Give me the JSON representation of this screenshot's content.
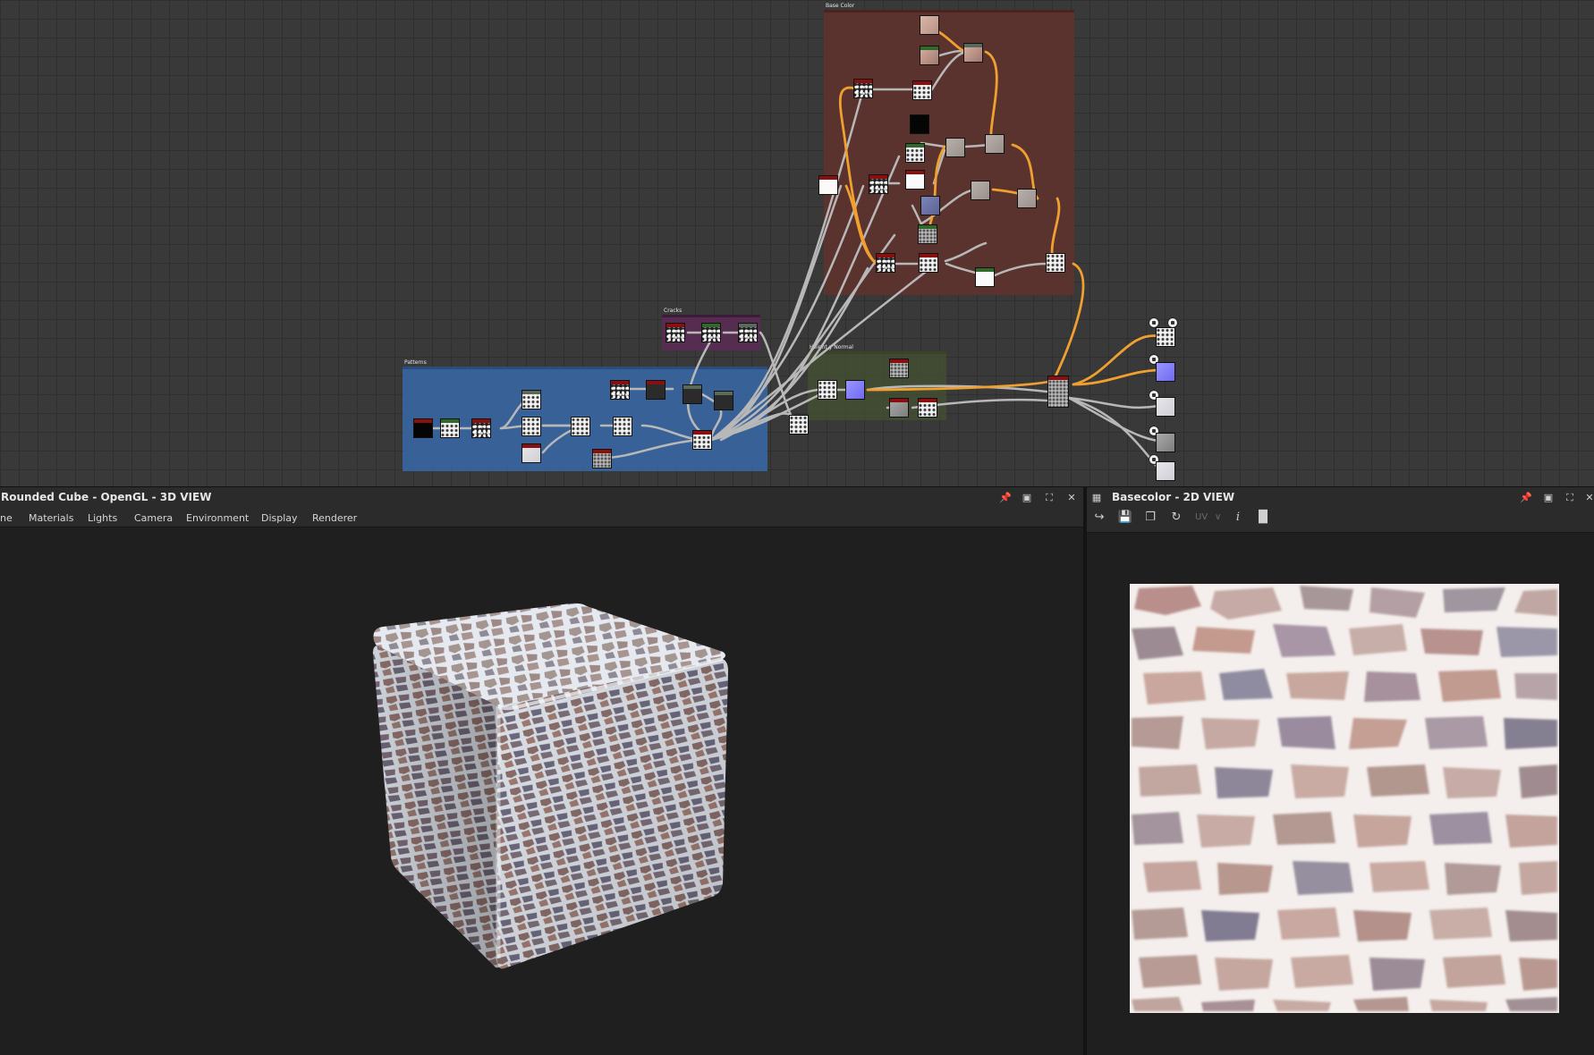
{
  "graph": {
    "frames": {
      "basecolor": "Base Color",
      "cracks": "Cracks",
      "height": "Height y Normal",
      "patterns": "Patterns"
    },
    "colors": {
      "wire": "#b8b8b8",
      "wire_highlight": "#f0a030",
      "header_red": "#8a1010",
      "header_green": "#2f6a2a",
      "header_gray": "#5a6a5a"
    }
  },
  "viewport3d": {
    "title": "Rounded Cube - OpenGL - 3D VIEW",
    "menu": [
      "ne",
      "Materials",
      "Lights",
      "Camera",
      "Environment",
      "Display",
      "Renderer"
    ]
  },
  "viewport2d": {
    "title": "Basecolor - 2D VIEW",
    "uv_label": "UV",
    "toolbar_icons": [
      "export-icon",
      "save-icon",
      "copy-icon",
      "refresh-icon",
      "uv-dropdown",
      "info-icon",
      "histogram-icon"
    ]
  },
  "window_icons": [
    "pin-icon",
    "float-icon",
    "maximize-icon",
    "close-icon"
  ]
}
